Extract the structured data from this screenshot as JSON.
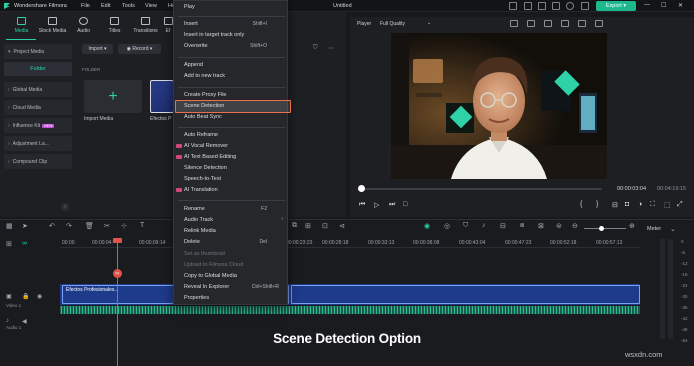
{
  "app": {
    "name": "Wondershare Filmora",
    "project": "Untitled"
  },
  "topmenu": [
    "File",
    "Edit",
    "Tools",
    "View",
    "He"
  ],
  "export_label": "Export",
  "colors": {
    "accent": "#2bd0a6",
    "highlight": "#e8734a",
    "export": "#1db88e",
    "track_video": "#1e3a8a"
  },
  "media_tabs": [
    {
      "label": "Media",
      "icon": "media-icon",
      "active": true
    },
    {
      "label": "Stock Media",
      "icon": "stock-media-icon",
      "active": false
    },
    {
      "label": "Audio",
      "icon": "music-note-icon",
      "active": false
    },
    {
      "label": "Titles",
      "icon": "text-icon",
      "active": false
    },
    {
      "label": "Transitions",
      "icon": "transitions-icon",
      "active": false
    },
    {
      "label": "Ef",
      "icon": "effects-icon",
      "active": false
    }
  ],
  "sidebar": {
    "project_media": "Project Media",
    "folder": "Folder",
    "items": [
      {
        "label": "Global Media"
      },
      {
        "label": "Cloud Media"
      },
      {
        "label": "Influence Kit",
        "badge": "NEW"
      },
      {
        "label": "Adjustment La..."
      },
      {
        "label": "Compound Clip"
      }
    ]
  },
  "media": {
    "import_btn": "Import",
    "record_btn": "Record",
    "folder_header": "FOLDER",
    "import_media": "Import Media",
    "clip_label": "Efectos P"
  },
  "player": {
    "label": "Player",
    "quality": "Full Quality",
    "current_time": "00:00:03:04",
    "total_time": "00:04:19:15",
    "scrub_progress": 0.01
  },
  "timeline": {
    "ticks": [
      "00:00",
      "00:00:04:",
      "00:00:09:14",
      "00:00:23:23",
      "00:00:28:18",
      "00:00:33:13",
      "00:00:38:08",
      "00:00:43:04",
      "00:00:47:23",
      "00:00:52:18",
      "00:00:57:13"
    ],
    "clip_name": "Efectos Profesionales...",
    "video_label": "Video 1",
    "audio_label": "Audio 1",
    "meter_label": "Meter",
    "meter_values": [
      "0",
      "-6",
      "-12",
      "-18",
      "-24",
      "-30",
      "-36",
      "-42",
      "-48",
      "-54"
    ]
  },
  "context_menu": {
    "items": [
      {
        "label": "Play",
        "shortcut": ""
      },
      {
        "label": "Insert",
        "shortcut": "Shift+I"
      },
      {
        "label": "Insert in target track only",
        "shortcut": ""
      },
      {
        "label": "Overwrite",
        "shortcut": "Shift+O"
      },
      {
        "label": "Append",
        "shortcut": ""
      },
      {
        "label": "Add to new track",
        "shortcut": ""
      },
      {
        "label": "Create Proxy File",
        "shortcut": ""
      },
      {
        "label": "Scene Detection",
        "shortcut": ""
      },
      {
        "label": "Auto Beat Sync",
        "shortcut": ""
      },
      {
        "label": "Auto Reframe",
        "shortcut": ""
      },
      {
        "label": "AI Vocal Remover",
        "shortcut": ""
      },
      {
        "label": "AI Text Based Editing",
        "shortcut": ""
      },
      {
        "label": "Silence Detection",
        "shortcut": ""
      },
      {
        "label": "Speech-to-Text",
        "shortcut": ""
      },
      {
        "label": "AI Translation",
        "shortcut": ""
      },
      {
        "label": "Rename",
        "shortcut": "F2"
      },
      {
        "label": "Audio Track",
        "shortcut": ""
      },
      {
        "label": "Relink Media",
        "shortcut": ""
      },
      {
        "label": "Delete",
        "shortcut": "Del"
      },
      {
        "label": "Set as thumbnail",
        "shortcut": ""
      },
      {
        "label": "Upload to Filmora Cloud",
        "shortcut": ""
      },
      {
        "label": "Copy to Global Media",
        "shortcut": ""
      },
      {
        "label": "Reveal In Explorer",
        "shortcut": "Ctrl+Shift+R"
      },
      {
        "label": "Properties",
        "shortcut": ""
      }
    ]
  },
  "caption": "Scene Detection Option",
  "watermark": "wsxdn.com"
}
